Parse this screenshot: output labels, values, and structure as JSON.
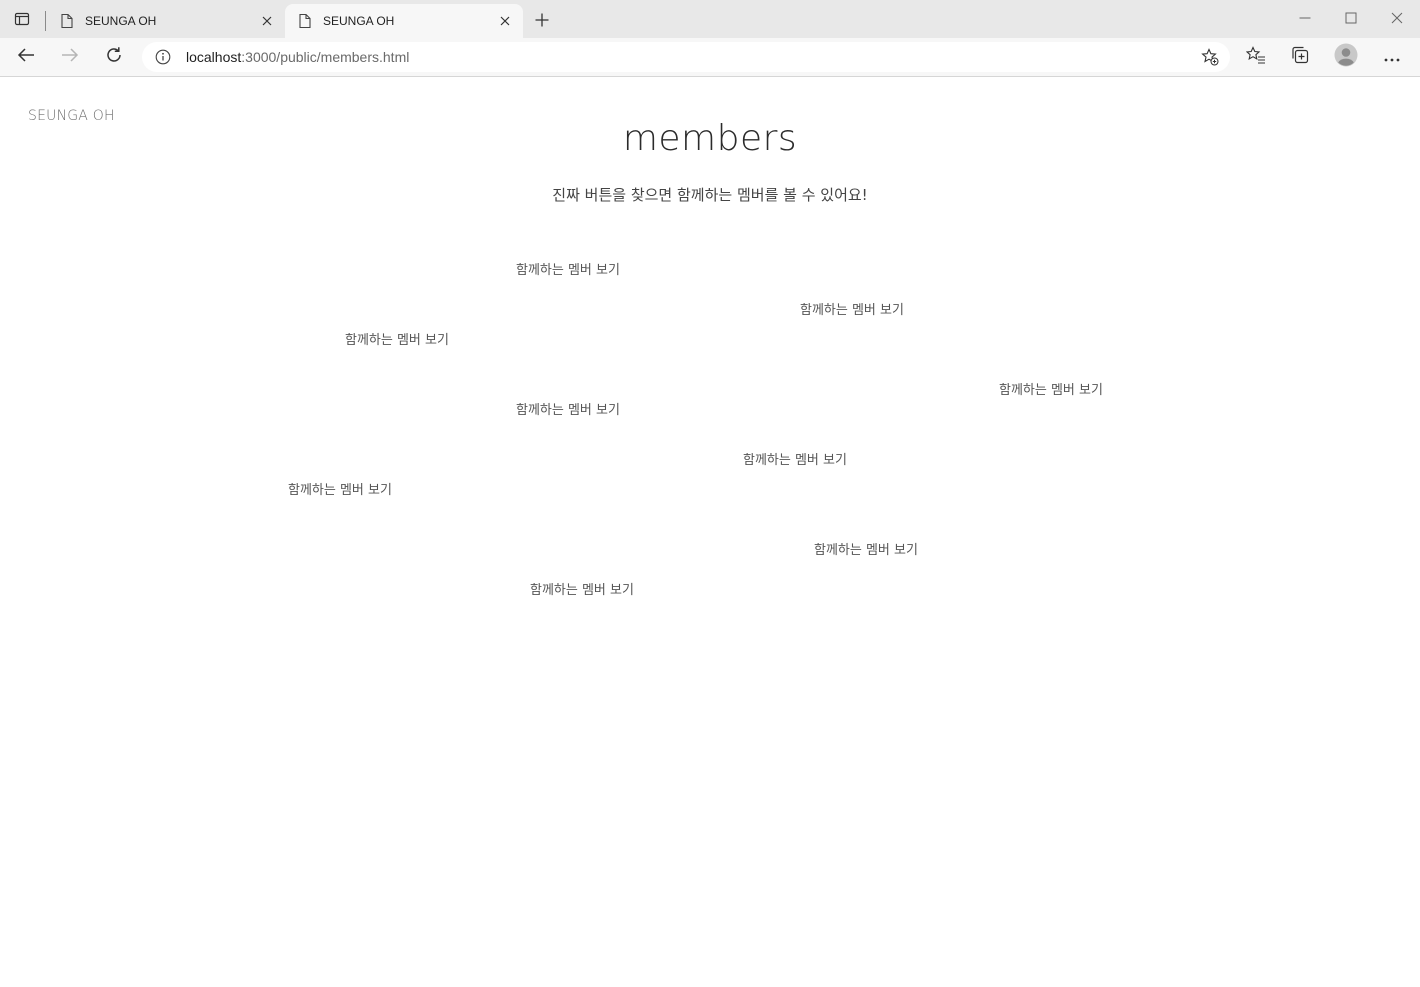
{
  "browser": {
    "tabs": [
      {
        "title": "SEUNGA OH",
        "active": false
      },
      {
        "title": "SEUNGA OH",
        "active": true
      }
    ],
    "address": {
      "host": "localhost",
      "path": ":3000/public/members.html"
    },
    "icons": {
      "tab_actions": "tab-actions-icon",
      "page": "page-icon",
      "close": "close-icon",
      "new_tab": "plus-icon",
      "minimize": "minimize-icon",
      "maximize": "maximize-icon",
      "window_close": "close-icon",
      "back": "back-arrow-icon",
      "forward": "forward-arrow-icon",
      "reload": "reload-icon",
      "site_info": "info-icon",
      "add_favorite": "star-plus-icon",
      "favorites": "favorites-icon",
      "collections": "collections-icon",
      "profile": "profile-icon",
      "more": "more-icon"
    }
  },
  "page": {
    "logo": "SEUNGA OH",
    "title": "members",
    "subtitle": "진짜 버튼을 찾으면 함께하는 멤버를 볼 수 있어요!",
    "member_buttons": [
      "함께하는 멤버 보기",
      "함께하는 멤버 보기",
      "함께하는 멤버 보기",
      "함께하는 멤버 보기",
      "함께하는 멤버 보기",
      "함께하는 멤버 보기",
      "함께하는 멤버 보기",
      "함께하는 멤버 보기",
      "함께하는 멤버 보기"
    ]
  },
  "colors": {
    "tabstrip": "#e8e8e8",
    "toolbar": "#f7f7f7",
    "page_bg": "#ffffff",
    "text_muted": "#6f6f6f"
  }
}
